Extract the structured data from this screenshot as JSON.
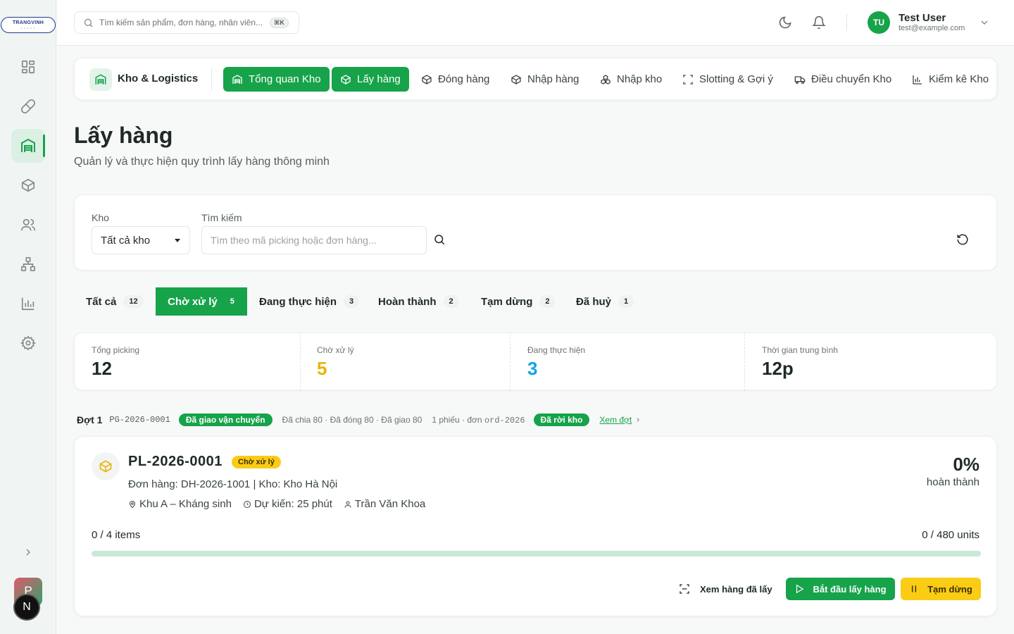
{
  "brand": {
    "logo_text": "TRANGVINH",
    "logo_sub": "• • • • •"
  },
  "topbar": {
    "search_placeholder": "Tìm kiếm sản phẩm, đơn hàng, nhân viên...",
    "shortcut": "⌘K",
    "user": {
      "initials": "TU",
      "name": "Test User",
      "email": "test@example.com"
    }
  },
  "sidebar": {
    "items": [
      {
        "icon": "dashboard-icon"
      },
      {
        "icon": "pill-icon"
      },
      {
        "icon": "warehouse-icon",
        "active": true
      },
      {
        "icon": "package-icon"
      },
      {
        "icon": "users-icon"
      },
      {
        "icon": "org-chart-icon"
      },
      {
        "icon": "bar-chart-icon"
      },
      {
        "icon": "settings-icon"
      }
    ],
    "workspace_initial": "P",
    "app_initial": "N"
  },
  "module": {
    "title": "Kho & Logistics",
    "tabs": [
      {
        "label": "Tổng quan Kho",
        "icon": "warehouse-icon"
      },
      {
        "label": "Lấy hàng",
        "icon": "package-icon"
      },
      {
        "label": "Đóng hàng",
        "icon": "package-icon"
      },
      {
        "label": "Nhập hàng",
        "icon": "package-icon"
      },
      {
        "label": "Nhập kho",
        "icon": "boxes-icon"
      },
      {
        "label": "Slotting & Gợi ý",
        "icon": "scan-icon"
      },
      {
        "label": "Điều chuyển Kho",
        "icon": "truck-icon"
      },
      {
        "label": "Kiểm kê Kho",
        "icon": "bar-chart-icon"
      }
    ]
  },
  "page": {
    "title": "Lấy hàng",
    "subtitle": "Quản lý và thực hiện quy trình lấy hàng thông minh"
  },
  "filters": {
    "warehouse_label": "Kho",
    "warehouse_value": "Tất cả kho",
    "search_label": "Tìm kiếm",
    "search_placeholder": "Tìm theo mã picking hoặc đơn hàng..."
  },
  "status_tabs": [
    {
      "label": "Tất cả",
      "count": "12"
    },
    {
      "label": "Chờ xử lý",
      "count": "5",
      "active": true
    },
    {
      "label": "Đang thực hiện",
      "count": "3"
    },
    {
      "label": "Hoàn thành",
      "count": "2"
    },
    {
      "label": "Tạm dừng",
      "count": "2"
    },
    {
      "label": "Đã huỷ",
      "count": "1"
    }
  ],
  "stats": [
    {
      "label": "Tổng picking",
      "value": "12",
      "color": "#1f2a26"
    },
    {
      "label": "Chờ xử lý",
      "value": "5",
      "color": "#eab308"
    },
    {
      "label": "Đang thực hiện",
      "value": "3",
      "color": "#0ea5e9"
    },
    {
      "label": "Thời gian trung bình",
      "value": "12p",
      "color": "#1f2a26"
    }
  ],
  "batch": {
    "title": "Đợt 1",
    "code": "PG-2026-0001",
    "status": "Đã giao vận chuyển",
    "summary": "Đã chia 80 · Đã đóng 80 · Đã giao 80",
    "slip_prefix": "1 phiếu · đơn ",
    "slip_order": "ord-2026",
    "exit_status": "Đã rời kho",
    "link": "Xem đợt"
  },
  "picking": {
    "code": "PL-2026-0001",
    "status": "Chờ xử lý",
    "order_line": "Đơn hàng: DH-2026-1001 | Kho: Kho Hà Nội",
    "zone": "Khu A – Kháng sinh",
    "estimate": "Dự kiến: 25 phút",
    "assignee": "Trần Văn Khoa",
    "percent": "0%",
    "percent_label": "hoàn thành",
    "progress": 0,
    "items": "0 / 4 items",
    "units": "0 / 480 units",
    "actions": {
      "view_picked": "Xem hàng đã lấy",
      "start": "Bắt đầu lấy hàng",
      "pause": "Tạm dừng"
    }
  },
  "colors": {
    "accent": "#16a34a",
    "warning": "#facc15",
    "info": "#0ea5e9"
  }
}
